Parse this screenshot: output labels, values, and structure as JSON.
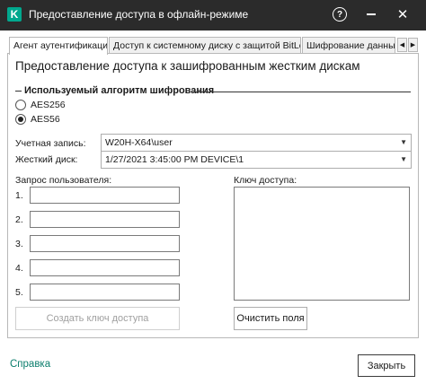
{
  "window": {
    "title": "Предоставление доступа в офлайн-режиме",
    "logo_letter": "K",
    "help_symbol": "?",
    "close_symbol": "✕"
  },
  "tabs": [
    {
      "label": "Агент аутентификации",
      "active": true
    },
    {
      "label": "Доступ к системному диску с защитой BitLocker",
      "active": false
    },
    {
      "label": "Шифрование данных",
      "active": false
    }
  ],
  "tab_scroll": {
    "left": "◀",
    "right": "▶"
  },
  "panel": {
    "heading": "Предоставление доступа к зашифрованным жестким дискам",
    "algorithm_group": {
      "title": "Используемый алгоритм шифрования",
      "options": [
        {
          "label": "AES256",
          "checked": false
        },
        {
          "label": "AES56",
          "checked": true
        }
      ]
    },
    "account": {
      "label": "Учетная запись:",
      "value": "W20H-X64\\user"
    },
    "disk": {
      "label": "Жесткий диск:",
      "value": "1/27/2021 3:45:00 PM  DEVICE\\1"
    },
    "user_request": {
      "label": "Запрос пользователя:",
      "rows": [
        {
          "num": "1.",
          "value": ""
        },
        {
          "num": "2.",
          "value": ""
        },
        {
          "num": "3.",
          "value": ""
        },
        {
          "num": "4.",
          "value": ""
        },
        {
          "num": "5.",
          "value": ""
        }
      ]
    },
    "access_key": {
      "label": "Ключ доступа:",
      "value": ""
    },
    "create_key_button": "Создать ключ доступа",
    "clear_fields_button": "Очистить поля"
  },
  "footer": {
    "help_link": "Справка",
    "close_button": "Закрыть"
  }
}
